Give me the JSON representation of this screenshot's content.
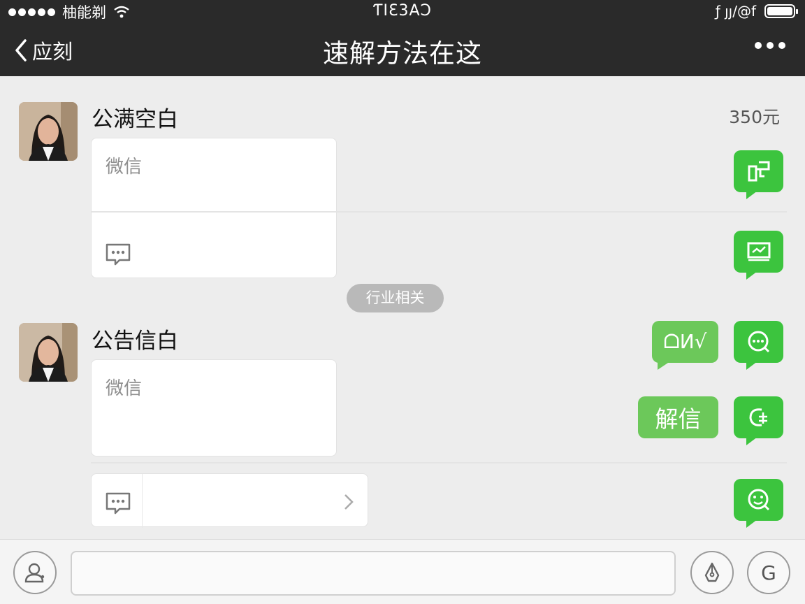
{
  "status_bar": {
    "carrier": "柚能剃",
    "time": "ƬIƐ3AƆ",
    "right_text": "ƒ  ȷȷ/@f"
  },
  "nav": {
    "back_label": "应刻",
    "title": "速解方法在这"
  },
  "chat": [
    {
      "name": "公满空白",
      "card_placeholder": "微信"
    },
    {
      "name": "公告信白",
      "card_placeholder": "微信"
    }
  ],
  "price": "350元",
  "divider_tag": "行业相关",
  "bubbles": [
    {
      "label": "ᗝИ√"
    },
    {
      "label": "解信"
    }
  ],
  "green_buttons": [
    {
      "icon": "share-icon"
    },
    {
      "icon": "screen-icon"
    },
    {
      "icon": "chat-icon"
    },
    {
      "icon": "phone-icon"
    },
    {
      "icon": "smile-icon"
    }
  ],
  "input": {
    "placeholder": "",
    "value": ""
  },
  "bottom_right_label": "G",
  "colors": {
    "header": "#2a2a2a",
    "green": "#3cc43e",
    "bubble_green": "#6cc85a",
    "background": "#ededed"
  }
}
